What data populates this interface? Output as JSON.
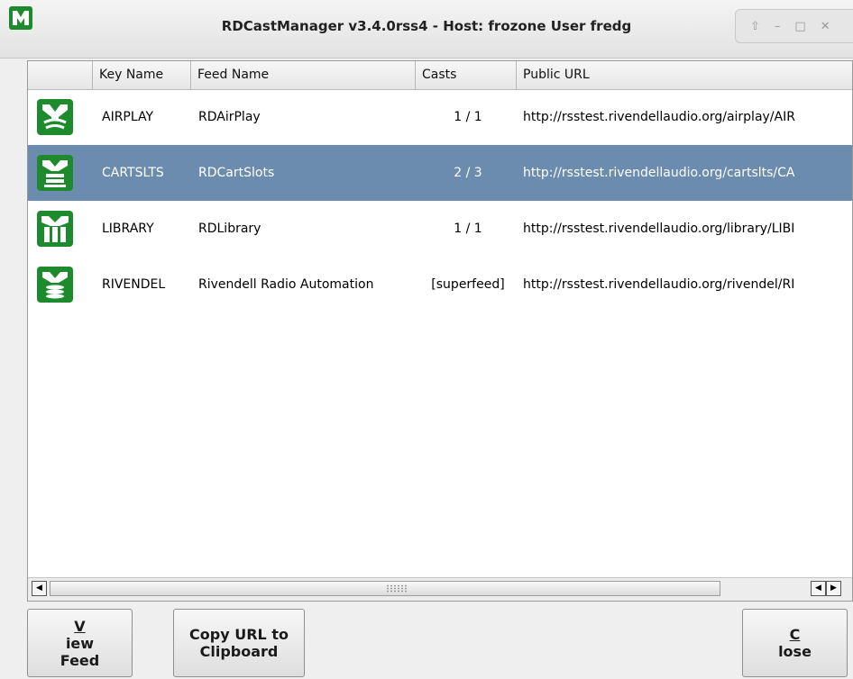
{
  "window": {
    "title": "RDCastManager v3.4.0rss4 - Host: frozone User fredg",
    "controls": {
      "shade_icon": "⇧",
      "minimize_icon": "–",
      "maximize_icon": "□",
      "close_icon": "✕"
    }
  },
  "list": {
    "columns": [
      "",
      "Key Name",
      "Feed Name",
      "Casts",
      "Public URL"
    ],
    "rows": [
      {
        "icon": "airplay-feed-icon",
        "key": "AIRPLAY",
        "feed": "RDAirPlay",
        "casts": "1 / 1",
        "url": "http://rsstest.rivendellaudio.org/airplay/AIR",
        "selected": false
      },
      {
        "icon": "cartslots-feed-icon",
        "key": "CARTSLTS",
        "feed": "RDCartSlots",
        "casts": "2 / 3",
        "url": "http://rsstest.rivendellaudio.org/cartslts/CA",
        "selected": true
      },
      {
        "icon": "library-feed-icon",
        "key": "LIBRARY",
        "feed": "RDLibrary",
        "casts": "1 / 1",
        "url": "http://rsstest.rivendellaudio.org/library/LIBI",
        "selected": false
      },
      {
        "icon": "rivendell-feed-icon",
        "key": "RIVENDEL",
        "feed": "Rivendell Radio Automation",
        "casts": "[superfeed]",
        "url": "http://rsstest.rivendellaudio.org/rivendel/RI",
        "selected": false
      }
    ]
  },
  "buttons": {
    "view_feed": {
      "line1_mn": "V",
      "line1_rest": "iew",
      "line2": "Feed"
    },
    "copy_url": {
      "line1": "Copy URL to",
      "line2": "Clipboard"
    },
    "close": {
      "mn": "C",
      "rest": "lose"
    }
  },
  "colors": {
    "selection": "#6b8cae",
    "icon_green": "#1e8a2e"
  }
}
